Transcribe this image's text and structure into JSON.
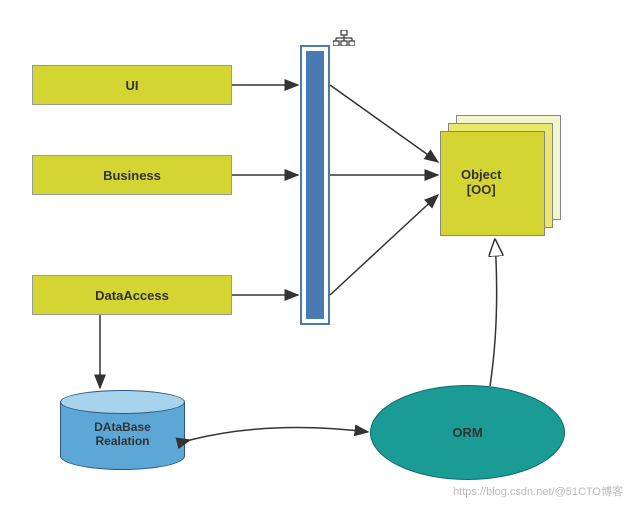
{
  "chart_data": {
    "type": "diagram",
    "title": "",
    "nodes": [
      {
        "id": "ui",
        "label": "UI",
        "shape": "rect",
        "fill": "#d4d432"
      },
      {
        "id": "business",
        "label": "Business",
        "shape": "rect",
        "fill": "#d4d432"
      },
      {
        "id": "dataaccess",
        "label": "DataAccess",
        "shape": "rect",
        "fill": "#d4d432"
      },
      {
        "id": "pipeline",
        "label": "",
        "shape": "vbar",
        "fill": "#4a7ab4",
        "icon": "network"
      },
      {
        "id": "object",
        "label": "Object\n[OO]",
        "shape": "note",
        "fill": "#d4d432"
      },
      {
        "id": "database",
        "label": "DAtaBase\nRealation",
        "shape": "cylinder",
        "fill": "#5da7d6"
      },
      {
        "id": "orm",
        "label": "ORM",
        "shape": "ellipse",
        "fill": "#1a9b96"
      }
    ],
    "edges": [
      {
        "from": "ui",
        "to": "pipeline",
        "style": "arrow"
      },
      {
        "from": "business",
        "to": "pipeline",
        "style": "arrow"
      },
      {
        "from": "dataaccess",
        "to": "pipeline",
        "style": "arrow"
      },
      {
        "from": "ui",
        "to": "object",
        "style": "arrow"
      },
      {
        "from": "business",
        "to": "object",
        "style": "arrow"
      },
      {
        "from": "dataaccess",
        "to": "object",
        "style": "arrow"
      },
      {
        "from": "dataaccess",
        "to": "database",
        "style": "arrow"
      },
      {
        "from": "orm",
        "to": "object",
        "style": "open-arrow"
      },
      {
        "from": "database",
        "to": "orm",
        "style": "bidirectional"
      }
    ]
  },
  "labels": {
    "ui": "UI",
    "business": "Business",
    "dataaccess": "DataAccess",
    "object_line1": "Object",
    "object_line2": "[OO]",
    "database_line1": "DAtaBase",
    "database_line2": "Realation",
    "orm": "ORM"
  },
  "watermark": "https://blog.csdn.net/@51CTO博客"
}
